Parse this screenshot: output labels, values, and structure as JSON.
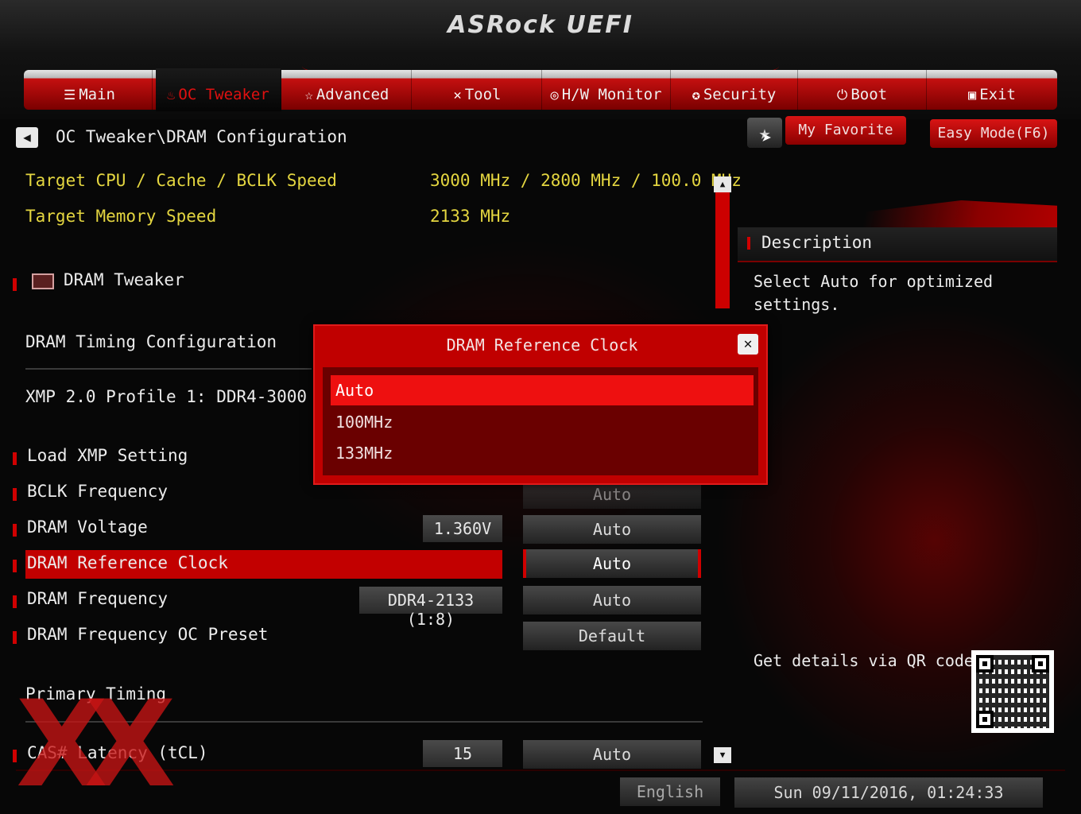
{
  "app": {
    "logo": "ASRock UEFI"
  },
  "tabs": [
    {
      "label": "Main",
      "icon": "list-icon",
      "glyph": "☰"
    },
    {
      "label": "OC Tweaker",
      "icon": "flame-icon",
      "glyph": "♨"
    },
    {
      "label": "Advanced",
      "icon": "star-icon",
      "glyph": "☆"
    },
    {
      "label": "Tool",
      "icon": "tools-icon",
      "glyph": "✕"
    },
    {
      "label": "H/W Monitor",
      "icon": "monitor-icon",
      "glyph": "◎"
    },
    {
      "label": "Security",
      "icon": "security-icon",
      "glyph": "✪"
    },
    {
      "label": "Boot",
      "icon": "power-icon",
      "glyph": "⏻"
    },
    {
      "label": "Exit",
      "icon": "exit-icon",
      "glyph": "▣"
    }
  ],
  "breadcrumb": "OC Tweaker\\DRAM Configuration",
  "favorite": {
    "star": "★",
    "label": "My Favorite"
  },
  "easy_mode": "Easy Mode(F6)",
  "info": {
    "cpu_label": "Target CPU / Cache / BCLK Speed",
    "cpu_value": "3000 MHz / 2800 MHz / 100.0 MHz",
    "mem_label": "Target Memory Speed",
    "mem_value": "2133 MHz"
  },
  "dram_tweaker": "DRAM Tweaker",
  "timing_config": "DRAM Timing Configuration",
  "xmp_profile": "XMP 2.0 Profile 1: DDR4-3000 15-15",
  "settings": {
    "load_xmp": "Load XMP Setting",
    "bclk": {
      "label": "BCLK Frequency",
      "option": "Auto"
    },
    "voltage": {
      "label": "DRAM Voltage",
      "value": "1.360V",
      "option": "Auto"
    },
    "ref_clock": {
      "label": "DRAM Reference Clock",
      "option": "Auto"
    },
    "frequency": {
      "label": "DRAM Frequency",
      "value": "DDR4-2133 (1:8)",
      "option": "Auto"
    },
    "oc_preset": {
      "label": "DRAM Frequency OC Preset",
      "option": "Default"
    },
    "primary_timing": "Primary Timing",
    "cas": {
      "label": "CAS# Latency (tCL)",
      "value": "15",
      "option": "Auto"
    }
  },
  "description": {
    "title": "Description",
    "text": "Select Auto for optimized settings.",
    "qr_label": "Get details via QR code"
  },
  "footer": {
    "language": "English",
    "datetime": "Sun 09/11/2016, 01:24:33"
  },
  "watermark": "XX",
  "modal": {
    "title": "DRAM Reference Clock",
    "close": "✕",
    "options": [
      "Auto",
      "100MHz",
      "133MHz"
    ],
    "selected_index": 0
  },
  "colors": {
    "accent": "#c00000",
    "highlight": "#ee1010",
    "info_text": "#e4d640"
  }
}
